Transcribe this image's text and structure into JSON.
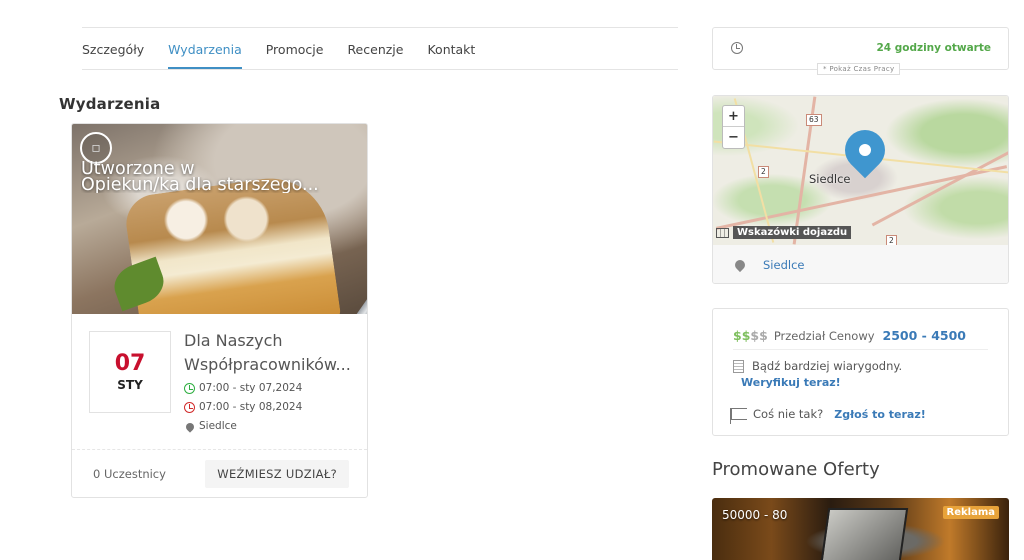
{
  "tabs": [
    {
      "label": "Szczegóły"
    },
    {
      "label": "Wydarzenia"
    },
    {
      "label": "Promocje"
    },
    {
      "label": "Recenzje"
    },
    {
      "label": "Kontakt"
    }
  ],
  "active_tab": "Wydarzenia",
  "section_title": "Wydarzenia",
  "event": {
    "overlay_line1": "Utworzone w",
    "overlay_line2": "Opiekun/ka dla starszego...",
    "date_day": "07",
    "date_month": "STY",
    "title_line1": "Dla Naszych",
    "title_line2": "Współpracowników...",
    "start": "07:00 - sty 07,2024",
    "end": "07:00 - sty 08,2024",
    "location": "Siedlce",
    "participants": "0 Uczestnicy",
    "join_label": "WEŹMIESZ UDZIAŁ?"
  },
  "hours": {
    "status": "24 godziny otwarte",
    "toggle_label": "* Pokaż Czas Pracy"
  },
  "map": {
    "zoom_in": "+",
    "zoom_out": "−",
    "city_label": "Siedlce",
    "road_63": "63",
    "road_2a": "2",
    "road_2b": "2",
    "directions_label": "Wskazówki dojazdu",
    "location_link": "Siedlce"
  },
  "info": {
    "price_dollars_on": "$$",
    "price_dollars_off": "$$",
    "price_label": "Przedział Cenowy",
    "price_value": "2500 - 4500",
    "verify_text": "Bądź bardziej wiarygodny.",
    "verify_link": "Weryfikuj teraz!",
    "report_text": "Coś nie tak?",
    "report_link": "Zgłoś to teraz!"
  },
  "promo": {
    "title": "Promowane Oferty",
    "card_price": "50000 - 80",
    "badge": "Reklama"
  },
  "colors": {
    "accent": "#3f8fc4",
    "link": "#3a7ab7",
    "open_green": "#54a84a",
    "date_red": "#c8102e",
    "badge_orange": "#e8a33a"
  }
}
